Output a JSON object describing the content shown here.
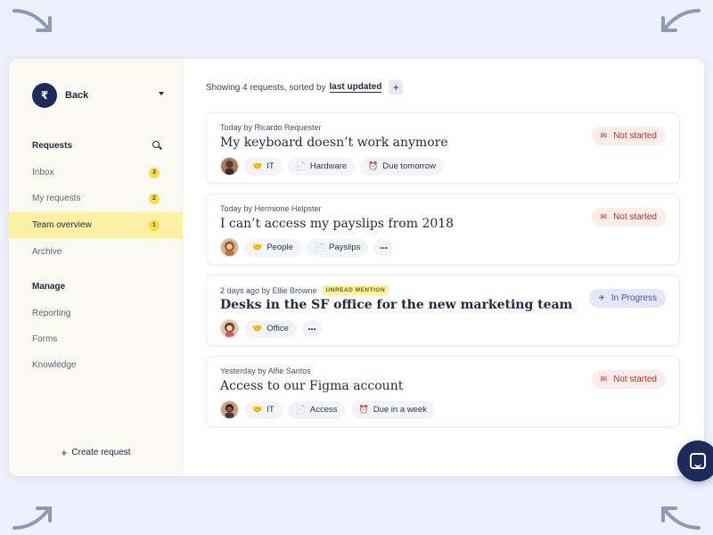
{
  "colors": {
    "accent_navy": "#1c2a5c",
    "active_nav": "#fbf0a4",
    "badge_yellow": "#f6df46",
    "not_started_bg": "#fcecea",
    "not_started_fg": "#b23a32",
    "in_progress_bg": "#e6e6fb",
    "in_progress_fg": "#4c4fa8"
  },
  "sidebar": {
    "logo_glyph": "₹",
    "back_label": "Back",
    "requests_heading": "Requests",
    "items": [
      {
        "label": "Inbox",
        "badge": "3"
      },
      {
        "label": "My requests",
        "badge": "2"
      },
      {
        "label": "Team overview",
        "badge": "1"
      },
      {
        "label": "Archive"
      }
    ],
    "manage_heading": "Manage",
    "manage_items": [
      {
        "label": "Reporting"
      },
      {
        "label": "Forms"
      },
      {
        "label": "Knowledge"
      }
    ],
    "create_label": "Create request"
  },
  "main": {
    "summary_text": "Showing 4 requests, sorted by",
    "sort_label": "last updated",
    "add_sort": "+"
  },
  "requests": [
    {
      "meta": "Today by Ricardo Requester",
      "title": "My keyboard doesn’t work anymore",
      "status": "Not started",
      "status_icon": "envelope-icon",
      "tags": [
        {
          "icon": "🤝",
          "label": "IT"
        },
        {
          "icon": "📄",
          "label": "Hardware"
        },
        {
          "icon": "⏰",
          "label": "Due tomorrow"
        }
      ]
    },
    {
      "meta": "Today by Hermione Helpster",
      "title": "I can’t access my payslips from 2018",
      "status": "Not started",
      "status_icon": "envelope-icon",
      "tags": [
        {
          "icon": "🤝",
          "label": "People"
        },
        {
          "icon": "📄",
          "label": "Payslips"
        }
      ],
      "more": "···"
    },
    {
      "meta": "2 days ago by Ellie Browne",
      "mention": "UNREAD MENTION",
      "title": "Desks in the SF office for the new marketing team",
      "status": "In Progress",
      "status_icon": "plane-icon",
      "tags": [
        {
          "icon": "🤝",
          "label": "Office"
        }
      ],
      "more": "···"
    },
    {
      "meta": "Yesterday by Alfie Santos",
      "title": "Access to our Figma account",
      "status": "Not started",
      "status_icon": "envelope-icon",
      "tags": [
        {
          "icon": "🤝",
          "label": "IT"
        },
        {
          "icon": "📄",
          "label": "Access"
        },
        {
          "icon": "⏰",
          "label": "Due in a week"
        }
      ]
    }
  ]
}
